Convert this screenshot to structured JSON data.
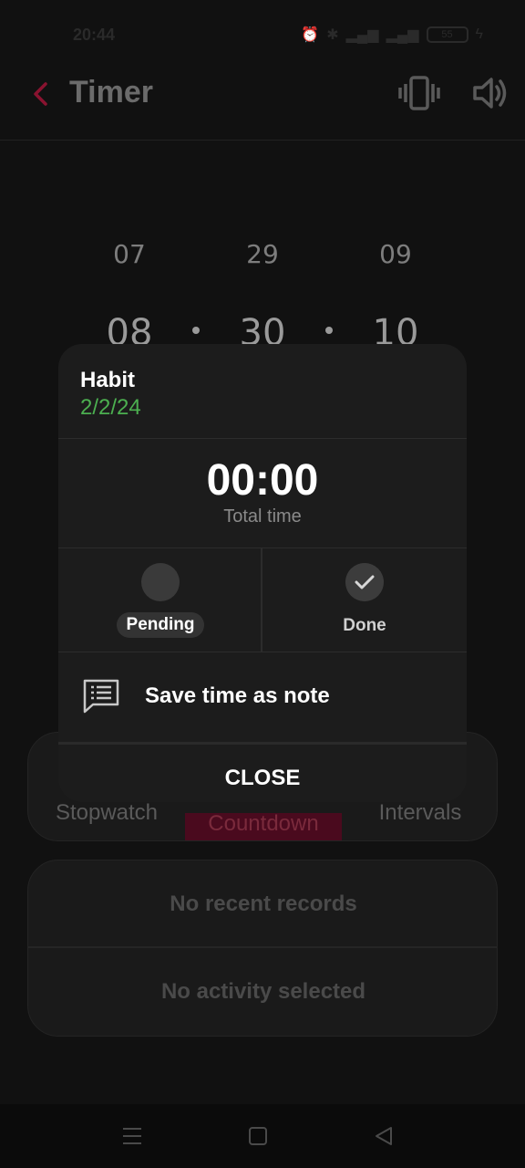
{
  "status_bar": {
    "time": "20:44",
    "battery": "55",
    "icons": [
      "alarm-icon",
      "bluetooth-icon",
      "signal-icon",
      "signal-icon",
      "battery-icon",
      "charging-icon"
    ]
  },
  "header": {
    "title": "Timer",
    "accent_color": "#b3173f"
  },
  "picker": {
    "top": [
      "07",
      "29",
      "09"
    ],
    "selected": [
      "08",
      "30",
      "10"
    ]
  },
  "mode_tabs": {
    "items": [
      "Stopwatch",
      "Countdown",
      "Intervals"
    ],
    "active": "Countdown"
  },
  "records": {
    "recent": "No recent records",
    "activity": "No activity selected"
  },
  "dialog": {
    "habit_name": "Habit",
    "habit_date": "2/2/24",
    "total_time_value": "00:00",
    "total_time_label": "Total time",
    "pending_label": "Pending",
    "done_label": "Done",
    "save_note_label": "Save time as note",
    "close_label": "CLOSE"
  },
  "nav": {
    "icons": [
      "menu-icon",
      "home-icon",
      "back-icon"
    ]
  }
}
